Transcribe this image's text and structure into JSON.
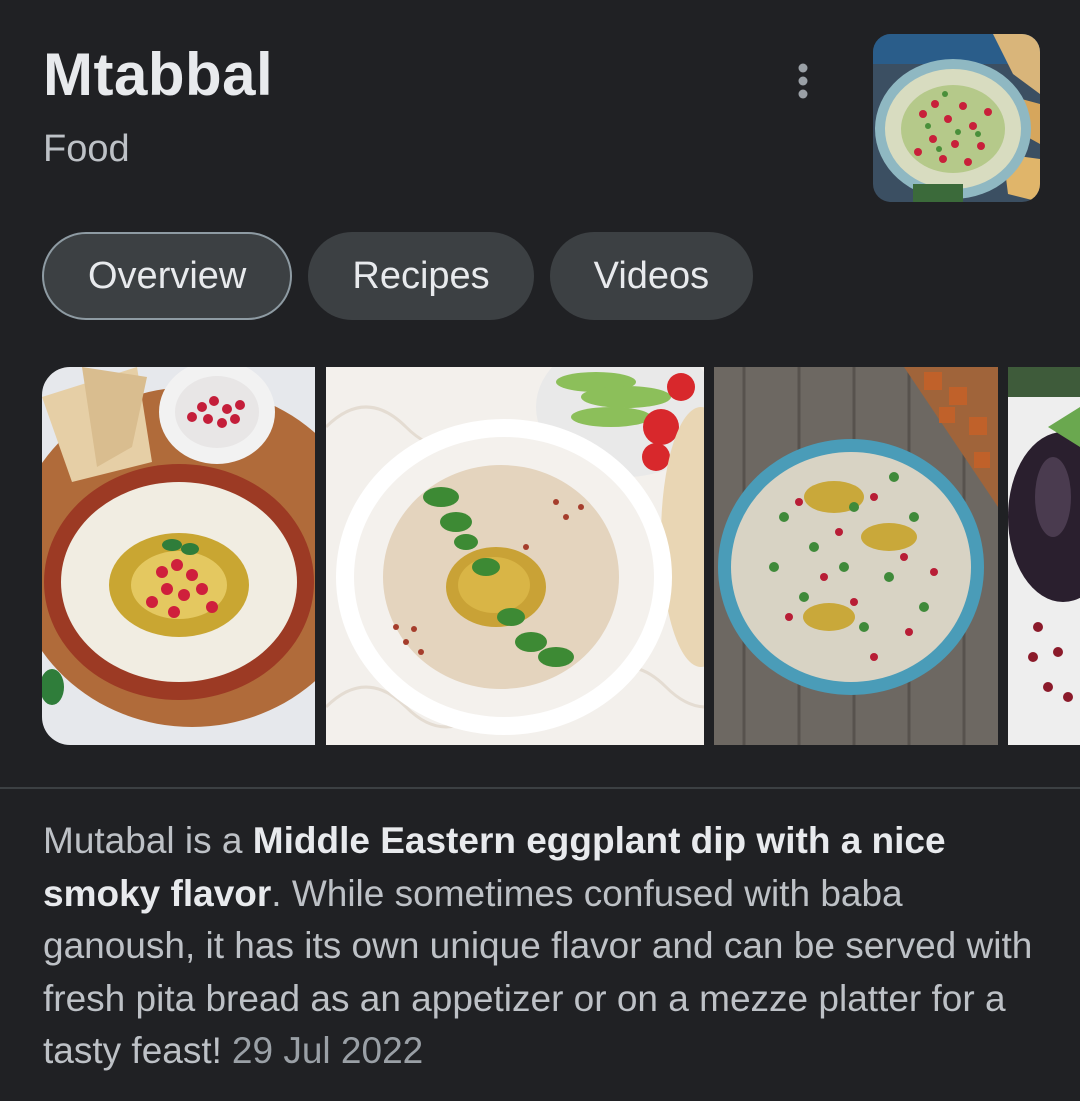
{
  "header": {
    "title": "Mtabbal",
    "subtitle": "Food"
  },
  "tabs": [
    {
      "label": "Overview",
      "active": true
    },
    {
      "label": "Recipes",
      "active": false
    },
    {
      "label": "Videos",
      "active": false
    }
  ],
  "description": {
    "intro": "Mutabal is a ",
    "bold": "Middle Eastern eggplant dip with a nice smoky flavor",
    "rest": ". While sometimes confused with baba ganoush, it has its own unique flavor and can be served with fresh pita bread as an appetizer or on a mezze platter for a tasty feast!",
    "date": "29 Jul 2022"
  },
  "icons": {
    "menu": "more-vert-icon"
  },
  "colors": {
    "background": "#202124",
    "chip": "#3c4043",
    "text_primary": "#e8eaed",
    "text_secondary": "#bdc1c6"
  }
}
